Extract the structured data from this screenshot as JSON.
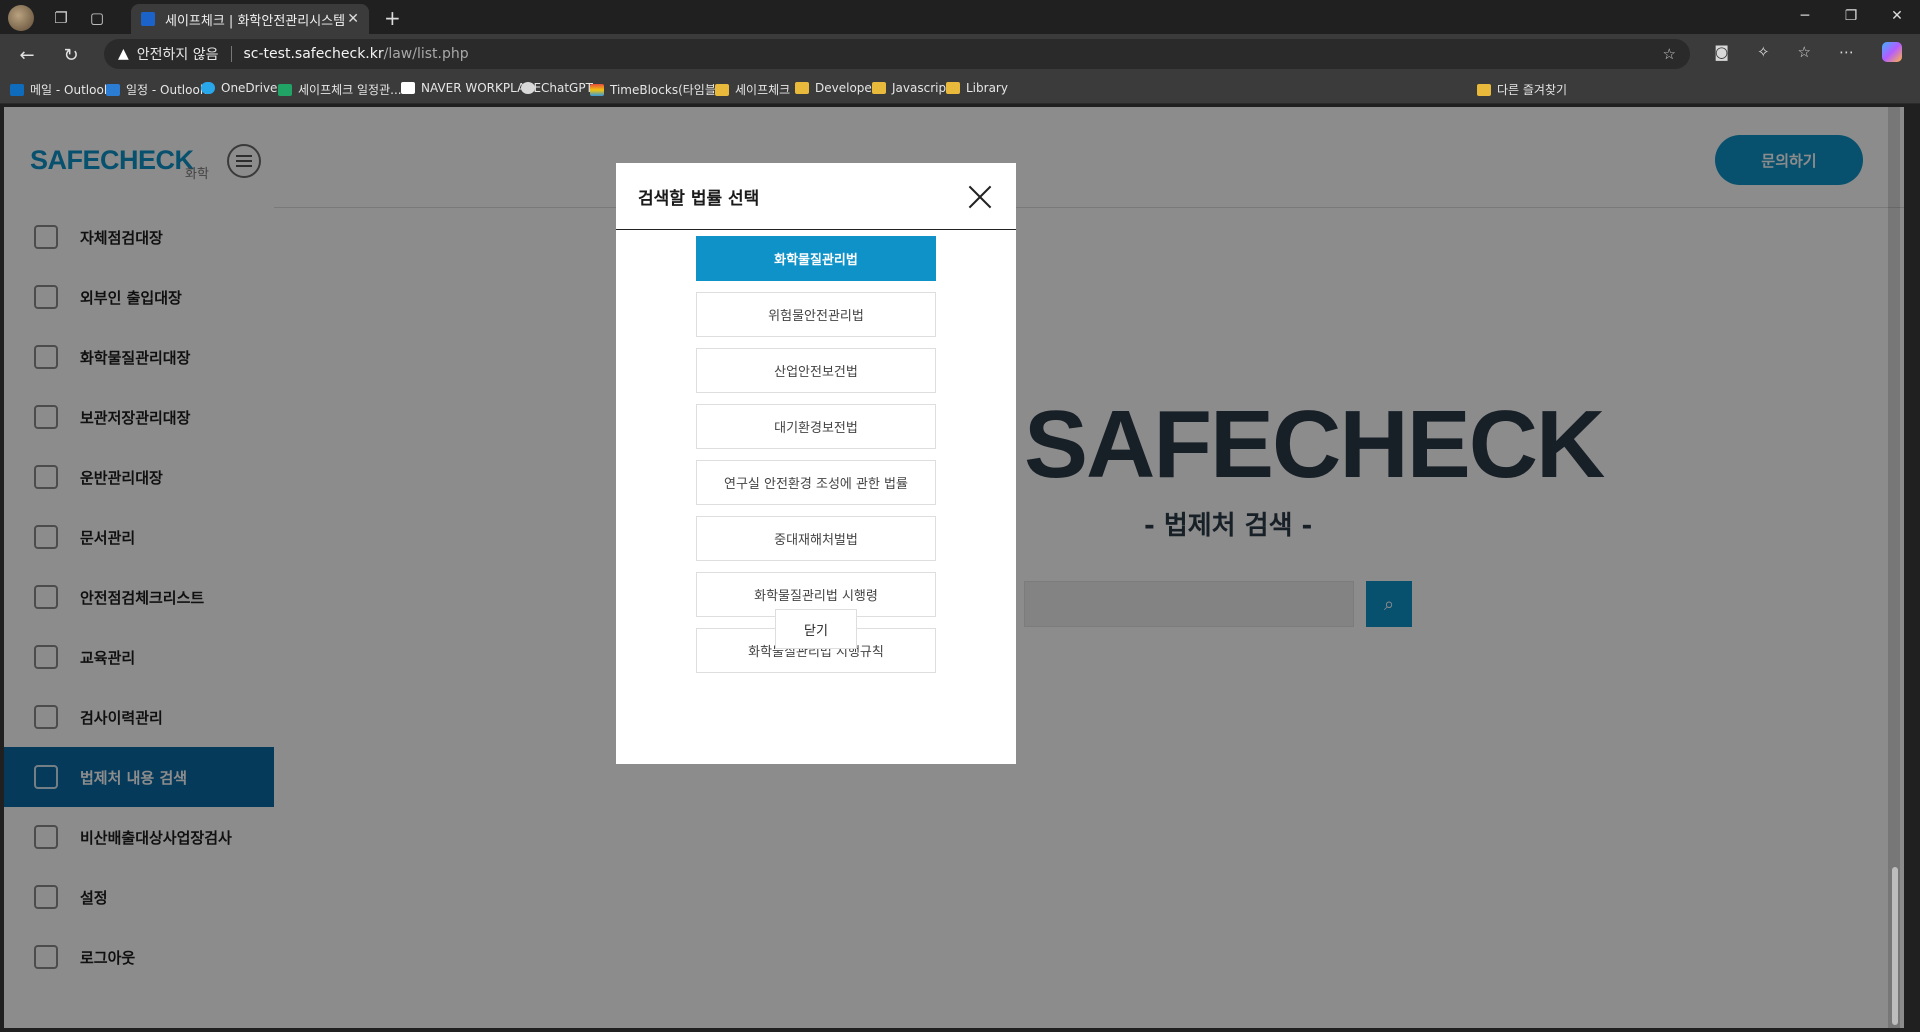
{
  "browser": {
    "tab_title": "세이프체크 | 화학안전관리시스템",
    "insecure_label": "안전하지 않음",
    "url_host": "sc-test.safecheck.kr",
    "url_path": "/law/list.php",
    "bookmarks": [
      {
        "label": "메일 - Outlook",
        "icon": "outlook-icon"
      },
      {
        "label": "일정 - Outlook",
        "icon": "calendar-icon"
      },
      {
        "label": "OneDrive",
        "icon": "onedrive-icon"
      },
      {
        "label": "세이프체크 일정관...",
        "icon": "sheet-icon"
      },
      {
        "label": "NAVER WORKPLACE",
        "icon": "naver-icon"
      },
      {
        "label": "ChatGPT",
        "icon": "chatgpt-icon"
      },
      {
        "label": "TimeBlocks(타임블...",
        "icon": "timeblocks-icon"
      },
      {
        "label": "세이프체크",
        "icon": "folder-icon"
      },
      {
        "label": "Developer",
        "icon": "folder-icon"
      },
      {
        "label": "Javascript",
        "icon": "folder-icon"
      },
      {
        "label": "Library",
        "icon": "folder-icon"
      }
    ],
    "other_bookmarks": "다른 즐겨찾기"
  },
  "sidebar": {
    "logo": "SAFECHECK",
    "logo_sub": "화학",
    "items": [
      {
        "label": "자체점검대장",
        "active": false
      },
      {
        "label": "외부인 출입대장",
        "active": false
      },
      {
        "label": "화학물질관리대장",
        "active": false
      },
      {
        "label": "보관저장관리대장",
        "active": false
      },
      {
        "label": "운반관리대장",
        "active": false
      },
      {
        "label": "문서관리",
        "active": false
      },
      {
        "label": "안전점검체크리스트",
        "active": false
      },
      {
        "label": "교육관리",
        "active": false
      },
      {
        "label": "검사이력관리",
        "active": false
      },
      {
        "label": "법제처 내용 검색",
        "active": true
      },
      {
        "label": "비산배출대상사업장검사",
        "active": false
      },
      {
        "label": "설정",
        "active": false
      },
      {
        "label": "로그아웃",
        "active": false
      }
    ]
  },
  "main": {
    "inquiry_button": "문의하기",
    "hero_title": "SAFECHECK",
    "hero_sub": "- 법제처 검색 -"
  },
  "modal": {
    "title": "검색할 법률 선택",
    "laws": [
      {
        "label": "화학물질관리법",
        "selected": true
      },
      {
        "label": "위험물안전관리법",
        "selected": false
      },
      {
        "label": "산업안전보건법",
        "selected": false
      },
      {
        "label": "대기환경보전법",
        "selected": false
      },
      {
        "label": "연구실 안전환경 조성에 관한 법률",
        "selected": false
      },
      {
        "label": "중대재해처벌법",
        "selected": false
      },
      {
        "label": "화학물질관리법 시행령",
        "selected": false
      },
      {
        "label": "화학물질관리법 시행규칙",
        "selected": false
      }
    ],
    "close_label": "닫기"
  },
  "colors": {
    "accent": "#0e92c8",
    "active_nav": "#0a6ba7"
  }
}
